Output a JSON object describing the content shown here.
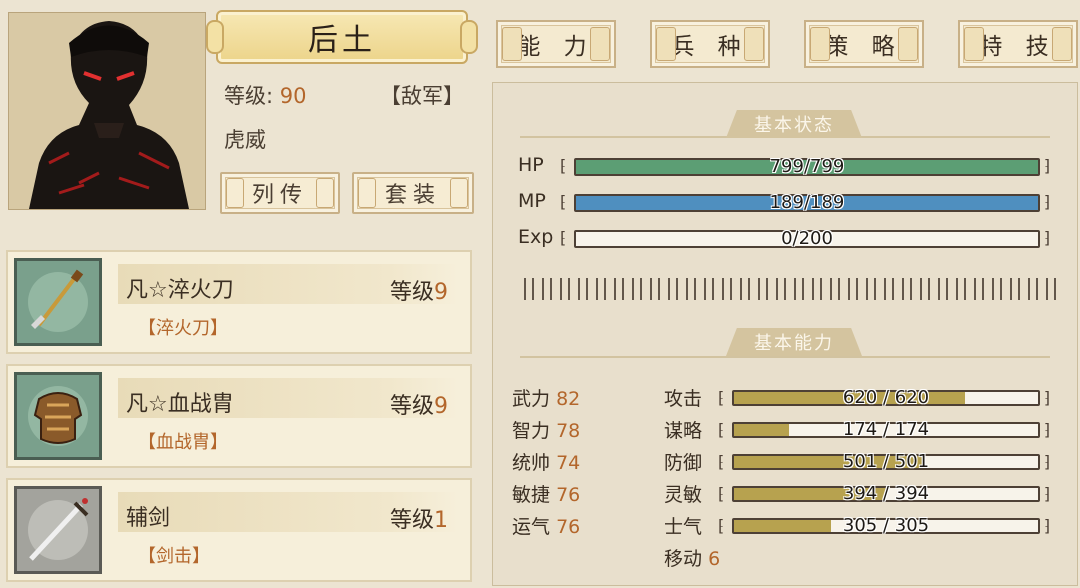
{
  "hero": {
    "name": "后土",
    "level_label": "等级:",
    "level_value": "90",
    "faction": "【敌军】",
    "title": "虎威"
  },
  "buttons": {
    "biography": "列传",
    "outfit": "套装"
  },
  "tabs": [
    {
      "label": "能 力"
    },
    {
      "label": "兵 种"
    },
    {
      "label": "策 略"
    },
    {
      "label": "特 技"
    }
  ],
  "sections": {
    "basic_status": "基本状态",
    "basic_ability": "基本能力"
  },
  "status_bars": [
    {
      "label": "HP",
      "text": "799/799",
      "fraction": 1.0,
      "color": "#5c9e74"
    },
    {
      "label": "MP",
      "text": "189/189",
      "fraction": 1.0,
      "color": "#4f8fbf"
    },
    {
      "label": "Exp",
      "text": "0/200",
      "fraction": 0.0,
      "color": "#5c9e74"
    }
  ],
  "attributes": [
    {
      "label": "武力",
      "value": "82"
    },
    {
      "label": "智力",
      "value": "78"
    },
    {
      "label": "统帅",
      "value": "74"
    },
    {
      "label": "敏捷",
      "value": "76"
    },
    {
      "label": "运气",
      "value": "76"
    }
  ],
  "combat_stats": [
    {
      "label": "攻击",
      "text": "620 / 620",
      "fraction": 0.76,
      "color": "#b7a24f"
    },
    {
      "label": "谋略",
      "text": "174 / 174",
      "fraction": 0.18,
      "color": "#b7a24f"
    },
    {
      "label": "防御",
      "text": "501 / 501",
      "fraction": 0.62,
      "color": "#b7a24f"
    },
    {
      "label": "灵敏",
      "text": "394 / 394",
      "fraction": 0.5,
      "color": "#b7a24f"
    },
    {
      "label": "士气",
      "text": "305 / 305",
      "fraction": 0.32,
      "color": "#b7a24f"
    }
  ],
  "movement": {
    "label": "移动",
    "value": "6"
  },
  "equipment": [
    {
      "name": "凡☆淬火刀",
      "level_label": "等级",
      "level": "9",
      "tag": "【淬火刀】",
      "icon": "blade-icon"
    },
    {
      "name": "凡☆血战胄",
      "level_label": "等级",
      "level": "9",
      "tag": "【血战胄】",
      "icon": "armor-icon"
    },
    {
      "name": "辅剑",
      "level_label": "等级",
      "level": "1",
      "tag": "【剑击】",
      "icon": "sword-icon"
    }
  ]
}
